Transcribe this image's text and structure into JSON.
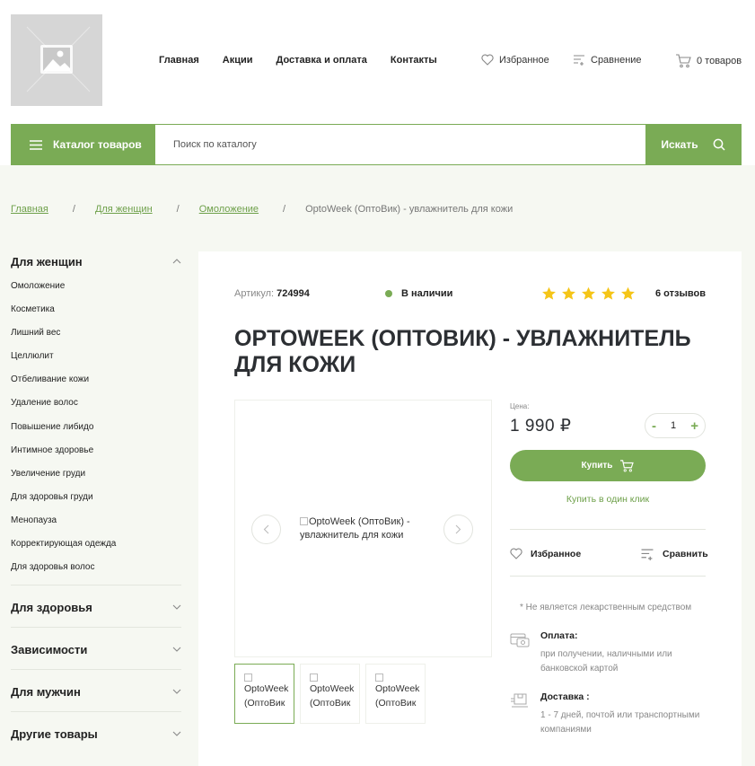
{
  "header": {
    "nav": [
      "Главная",
      "Акции",
      "Доставка и оплата",
      "Контакты"
    ],
    "favorites_label": "Избранное",
    "compare_label": "Сравнение",
    "cart_label": "0 товаров"
  },
  "search": {
    "catalog_label": "Каталог товаров",
    "placeholder": "Поиск по каталогу",
    "button_label": "Искать"
  },
  "breadcrumb": {
    "links": [
      "Главная",
      "Для женщин",
      "Омоложение"
    ],
    "current": "OptoWeek (ОптоВик) - увлажнитель для кожи"
  },
  "sidebar": {
    "open_category": {
      "title": "Для женщин",
      "items": [
        "Омоложение",
        "Косметика",
        "Лишний вес",
        "Целлюлит",
        "Отбеливание кожи",
        "Удаление волос",
        "Повышение либидо",
        "Интимное здоровье",
        "Увеличение груди",
        "Для здоровья груди",
        "Менопауза",
        "Корректирующая одежда",
        "Для здоровья волос"
      ]
    },
    "categories": [
      "Для здоровья",
      "Зависимости",
      "Для мужчин",
      "Другие товары"
    ]
  },
  "product": {
    "article_label": "Артикул:",
    "article": "724994",
    "stock": "В наличии",
    "rating": 5,
    "reviews": "6 отзывов",
    "title": "OptoWeek (ОптоВик) - увлажнитель для кожи",
    "image_alt": "OptoWeek (ОптоВик) - увлажнитель для кожи",
    "thumbs": [
      "OptoWeek (ОптоВик",
      "OptoWeek (ОптоВик",
      "OptoWeek (ОптоВик"
    ],
    "price_label": "Цена:",
    "price": "1 990 ₽",
    "quantity": "1",
    "qty_minus": "-",
    "qty_plus": "+",
    "buy_label": "Купить",
    "one_click_label": "Купить в один клик",
    "favorite_label": "Избранное",
    "compare_label": "Сравнить",
    "note": "* Не является лекарственным средством",
    "payment_title": "Оплата:",
    "payment_text": "при получении, наличными или банковской картой",
    "delivery_title": "Доставка :",
    "delivery_text": "1 - 7 дней, почтой или транспортными компаниями"
  },
  "colors": {
    "accent": "#7aab55",
    "star": "#f5c518",
    "page_bg": "#f6f8f2"
  },
  "icons": [
    "image-placeholder-icon",
    "heart-icon",
    "compare-icon",
    "cart-icon",
    "menu-icon",
    "search-icon",
    "chevron-up-icon",
    "chevron-down-icon",
    "star-icon",
    "arrow-left-icon",
    "arrow-right-icon",
    "payment-icon",
    "delivery-icon"
  ]
}
